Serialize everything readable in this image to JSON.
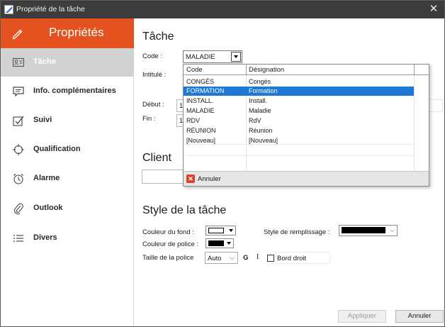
{
  "window": {
    "title": "Propriété de la tâche",
    "close_glyph": "✕"
  },
  "sidebar": {
    "header": "Propriétés",
    "header_color": "#e4531f",
    "items": [
      {
        "label": "Tâche",
        "icon": "contact-card-icon",
        "active": true
      },
      {
        "label": "Info. complémentaires",
        "icon": "comment-icon",
        "active": false
      },
      {
        "label": "Suivi",
        "icon": "checkbox-icon",
        "active": false
      },
      {
        "label": "Qualification",
        "icon": "target-icon",
        "active": false
      },
      {
        "label": "Alarme",
        "icon": "alarm-clock-icon",
        "active": false
      },
      {
        "label": "Outlook",
        "icon": "attachment-icon",
        "active": false
      },
      {
        "label": "Divers",
        "icon": "list-icon",
        "active": false
      }
    ]
  },
  "task": {
    "heading": "Tâche",
    "code_label": "Code :",
    "code_value": "MALADIE",
    "intitule_label": "Intitulé :",
    "debut_label": "Début :",
    "debut_value": "1",
    "fin_label": "Fin :",
    "fin_value": "1"
  },
  "dropdown": {
    "col_code": "Code",
    "col_designation": "Désignation",
    "rows": [
      {
        "code": "CONGÉS",
        "designation": "Congés",
        "selected": false
      },
      {
        "code": "FORMATION",
        "designation": "Formation",
        "selected": true
      },
      {
        "code": "INSTALL.",
        "designation": "Install.",
        "selected": false
      },
      {
        "code": "MALADIE",
        "designation": "Maladie",
        "selected": false
      },
      {
        "code": "RDV",
        "designation": "RdV",
        "selected": false
      },
      {
        "code": "RÉUNION",
        "designation": "Réunion",
        "selected": false
      },
      {
        "code": "[Nouveau]",
        "designation": "[Nouveau]",
        "selected": false
      }
    ],
    "cancel_label": "Annuler",
    "selection_color": "#1e78d4"
  },
  "client": {
    "heading": "Client"
  },
  "style": {
    "heading": "Style de la tâche",
    "fond_label": "Couleur du fond :",
    "fond_color": "#ffffff",
    "police_label": "Couleur de police :",
    "police_color": "#000000",
    "taille_label": "Taille de la police",
    "taille_value": "Auto",
    "bold_glyph": "G",
    "italic_glyph": "I",
    "bord_droit_label": "Bord droit",
    "bord_droit_checked": false,
    "remplissage_label": "Style de remplissage :",
    "remplissage_color": "#000000"
  },
  "footer": {
    "apply_label": "Appliquer",
    "apply_enabled": false,
    "cancel_label": "Annuler"
  }
}
